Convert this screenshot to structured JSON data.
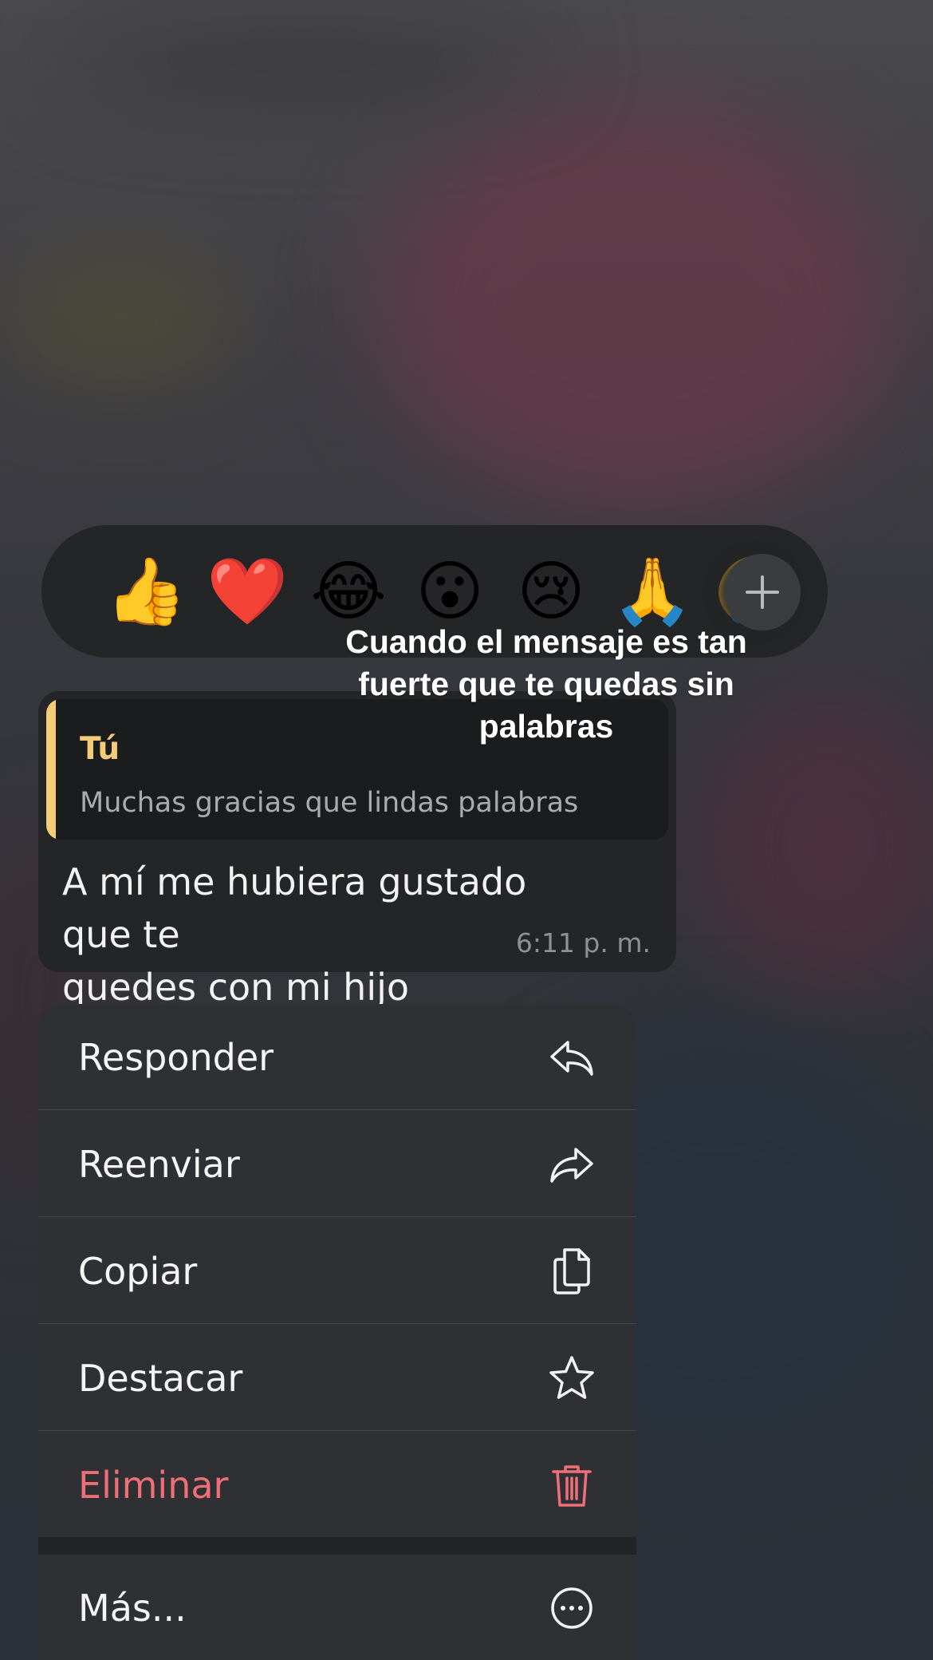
{
  "reactions": {
    "emojis": [
      "👍",
      "❤️",
      "😂",
      "😮",
      "😢",
      "🙏",
      "🤣"
    ],
    "add_label": "+"
  },
  "caption": {
    "lines": [
      "Cuando el mensaje es tan",
      "fuerte que te quedas sin",
      "palabras"
    ]
  },
  "message": {
    "quoted_author": "Tú",
    "quoted_text": "Muchas gracias que lindas palabras",
    "text_lines": [
      "A mí me hubiera gustado que te",
      "quedes con mi hijo"
    ],
    "time": "6:11 p. m."
  },
  "menu": {
    "items": [
      {
        "label": "Responder",
        "icon": "reply-icon"
      },
      {
        "label": "Reenviar",
        "icon": "forward-icon"
      },
      {
        "label": "Copiar",
        "icon": "copy-icon"
      },
      {
        "label": "Destacar",
        "icon": "star-icon"
      },
      {
        "label": "Eliminar",
        "icon": "trash-icon"
      }
    ],
    "more": {
      "label": "Más...",
      "icon": "more-dots-icon"
    }
  },
  "colors": {
    "quote_accent": "#f4cc78",
    "danger": "#ef6f79",
    "bubble": "#232527",
    "menu": "#2e3033"
  }
}
